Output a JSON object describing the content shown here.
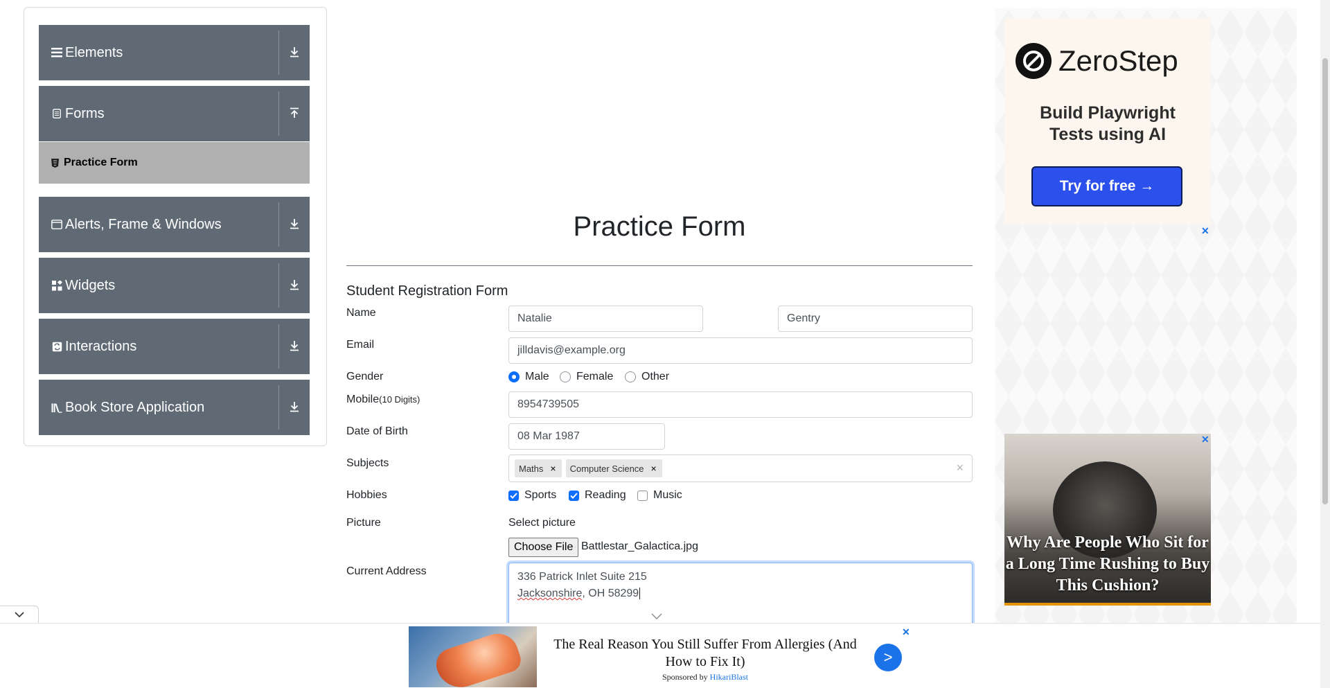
{
  "sidebar": {
    "groups": [
      {
        "label": "Elements",
        "icon": "hamburger-icon",
        "arrow": "download-icon"
      },
      {
        "label": "Forms",
        "icon": "document-icon",
        "arrow": "upload-icon"
      },
      {
        "label": "Alerts, Frame & Windows",
        "icon": "window-icon",
        "arrow": "download-icon"
      },
      {
        "label": "Widgets",
        "icon": "widgets-icon",
        "arrow": "download-icon"
      },
      {
        "label": "Interactions",
        "icon": "interactions-icon",
        "arrow": "download-icon"
      },
      {
        "label": "Book Store Application",
        "icon": "books-icon",
        "arrow": "download-icon"
      }
    ],
    "active_item": {
      "label": "Practice Form",
      "icon": "html5-icon"
    }
  },
  "main": {
    "title": "Practice Form",
    "form_heading": "Student Registration Form",
    "labels": {
      "name": "Name",
      "email": "Email",
      "gender": "Gender",
      "mobile": "Mobile",
      "mobile_hint": "(10 Digits)",
      "dob": "Date of Birth",
      "subjects": "Subjects",
      "hobbies": "Hobbies",
      "picture": "Picture",
      "address": "Current Address"
    },
    "first_name": "Natalie",
    "last_name": "Gentry",
    "email": "jilldavis@example.org",
    "gender_options": [
      {
        "label": "Male",
        "selected": true
      },
      {
        "label": "Female",
        "selected": false
      },
      {
        "label": "Other",
        "selected": false
      }
    ],
    "mobile": "8954739505",
    "dob": "08 Mar 1987",
    "subjects": [
      "Maths",
      "Computer Science"
    ],
    "hobbies": [
      {
        "label": "Sports",
        "checked": true
      },
      {
        "label": "Reading",
        "checked": true
      },
      {
        "label": "Music",
        "checked": false
      }
    ],
    "select_picture": "Select picture",
    "choose_file": "Choose File",
    "file_name": "Battlestar_Galactica.jpg",
    "address_line1": "336 Patrick Inlet Suite 215",
    "address_line2_a": "Jacksonshire",
    "address_line2_b": ", OH 58299"
  },
  "ads": {
    "zerostep_brand": "ZeroStep",
    "zerostep_tagline_1": "Build Playwright",
    "zerostep_tagline_2": "Tests using AI",
    "zerostep_button": "Try for free →",
    "cushion_caption": "Why Are People Who Sit for a Long Time Rushing to Buy This Cushion?",
    "bottom_headline": "The Real Reason You Still Suffer From Allergies (And How to Fix It)",
    "bottom_sponsored": "Sponsored by",
    "bottom_sponsor": "HikariBlast",
    "bottom_go": ">",
    "close": "✕"
  },
  "colors": {
    "sidebar_group_bg": "#5f6a75",
    "active_item_bg": "#b0b0b0",
    "accent": "#0d6efd",
    "ad_button": "#2b50ec"
  }
}
